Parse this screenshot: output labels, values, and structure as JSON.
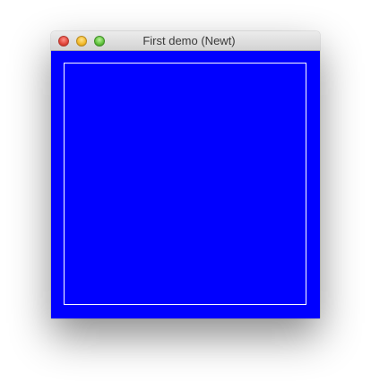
{
  "window": {
    "title": "First demo (Newt)",
    "controls": {
      "close": "close-icon",
      "minimize": "minimize-icon",
      "zoom": "zoom-icon"
    }
  },
  "canvas": {
    "background_color": "#0000ff",
    "frame_color": "#ffffff"
  }
}
